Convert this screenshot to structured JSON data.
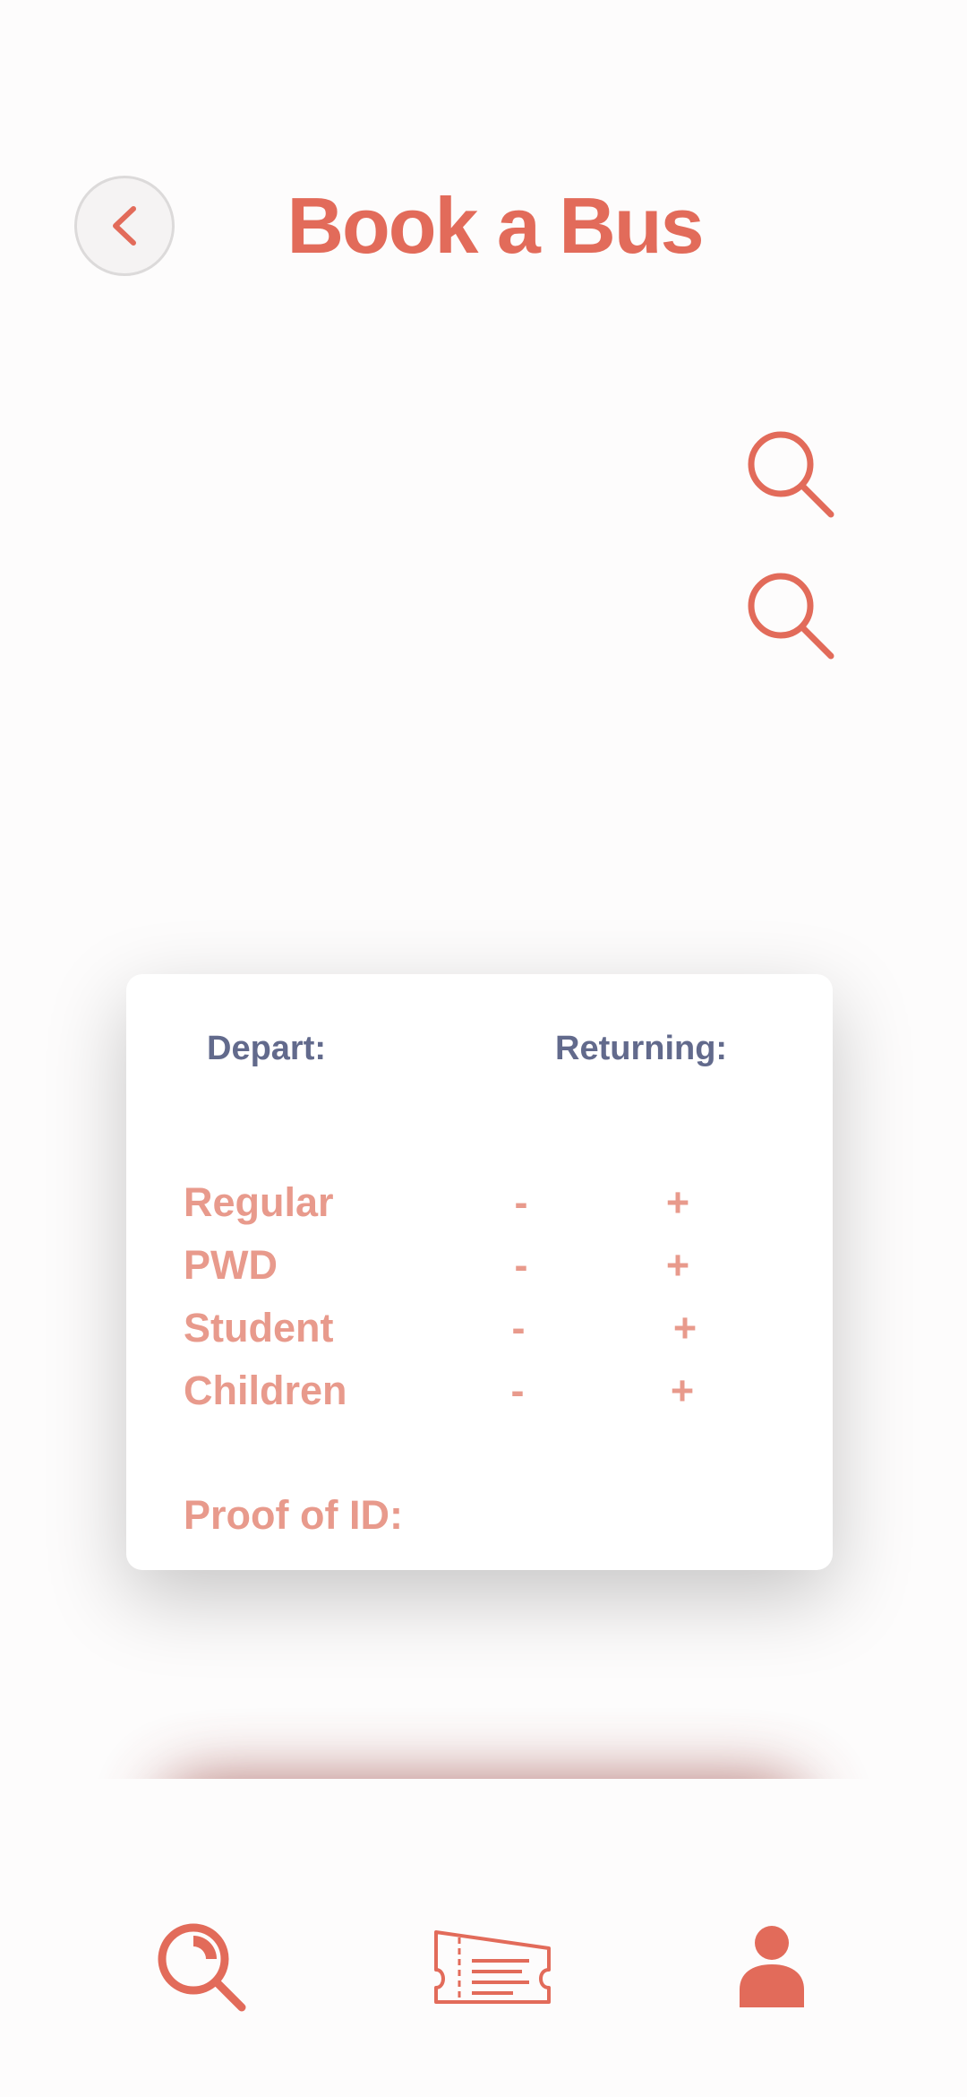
{
  "header": {
    "title": "Book a Bus",
    "back_icon": "chevron-left-icon"
  },
  "search": {
    "from_icon": "search-icon",
    "to_icon": "search-icon"
  },
  "card": {
    "depart_label": "Depart:",
    "returning_label": "Returning:",
    "passengers": [
      {
        "label": "Regular",
        "minus": "-",
        "plus": "+"
      },
      {
        "label": "PWD",
        "minus": "-",
        "plus": "+"
      },
      {
        "label": "Student",
        "minus": "-",
        "plus": "+"
      },
      {
        "label": "Children",
        "minus": "-",
        "plus": "+"
      }
    ],
    "proof_label": "Proof of ID:"
  },
  "nav": {
    "items": [
      {
        "name": "search",
        "icon": "search-icon"
      },
      {
        "name": "tickets",
        "icon": "ticket-icon"
      },
      {
        "name": "profile",
        "icon": "user-icon"
      }
    ]
  },
  "colors": {
    "accent": "#e26b5a",
    "soft_accent": "#e89a8c",
    "label": "#626a8c"
  }
}
